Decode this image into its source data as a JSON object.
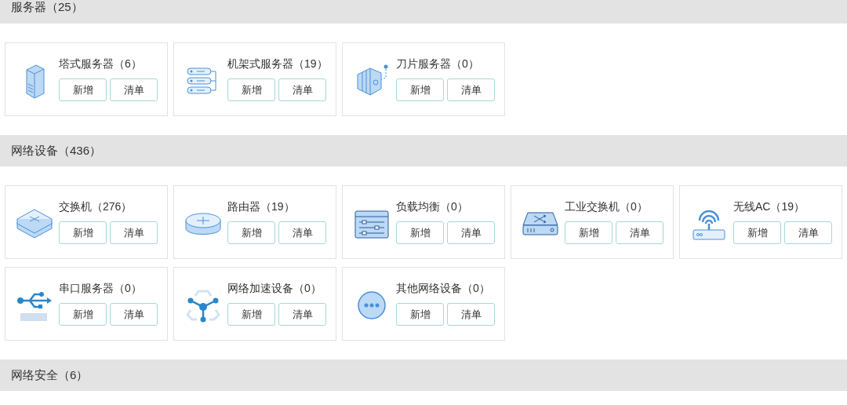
{
  "sections": [
    {
      "title": "服务器（25）",
      "rows": [
        [
          {
            "kind": "tower",
            "title": "塔式服务器（6）",
            "buttons": [
              "新增",
              "清单"
            ]
          },
          {
            "kind": "rack",
            "title": "机架式服务器（19）",
            "buttons": [
              "新增",
              "清单"
            ]
          },
          {
            "kind": "blade",
            "title": "刀片服务器（0）",
            "buttons": [
              "新增",
              "清单"
            ]
          }
        ]
      ]
    },
    {
      "title": "网络设备（436）",
      "rows": [
        [
          {
            "kind": "switch",
            "title": "交换机（276）",
            "buttons": [
              "新增",
              "清单"
            ]
          },
          {
            "kind": "router",
            "title": "路由器（19）",
            "buttons": [
              "新增",
              "清单"
            ]
          },
          {
            "kind": "balancer",
            "title": "负载均衡（0）",
            "buttons": [
              "新增",
              "清单"
            ]
          },
          {
            "kind": "industrial",
            "title": "工业交换机（0）",
            "buttons": [
              "新增",
              "清单"
            ]
          },
          {
            "kind": "wireless",
            "title": "无线AC（19）",
            "buttons": [
              "新增",
              "清单"
            ]
          }
        ],
        [
          {
            "kind": "usb",
            "title": "串口服务器（0）",
            "buttons": [
              "新增",
              "清单"
            ]
          },
          {
            "kind": "nodes",
            "title": "网络加速设备（0）",
            "buttons": [
              "新增",
              "清单"
            ]
          },
          {
            "kind": "more",
            "title": "其他网络设备（0）",
            "buttons": [
              "新增",
              "清单"
            ]
          }
        ]
      ]
    },
    {
      "title": "网络安全（6）"
    }
  ]
}
